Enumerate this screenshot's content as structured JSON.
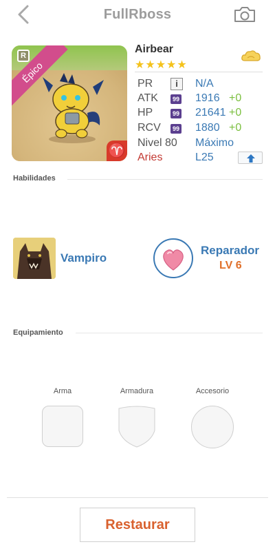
{
  "header": {
    "title": "FullRboss"
  },
  "monster": {
    "name": "Airbear",
    "stars": "★★★★★",
    "rarity": "Épico",
    "rank_badge": "R",
    "sign_glyph": "♈",
    "stats": [
      {
        "label": "PR",
        "badge": "i",
        "value": "N/A",
        "plus": ""
      },
      {
        "label": "ATK",
        "badge": "99",
        "value": "1916",
        "plus": "+0"
      },
      {
        "label": "HP",
        "badge": "99",
        "value": "21641",
        "plus": "+0"
      },
      {
        "label": "RCV",
        "badge": "99",
        "value": "1880",
        "plus": "+0"
      }
    ],
    "level": {
      "label": "Nivel 80",
      "value": "Máximo"
    },
    "sign": {
      "label": "Aries",
      "value": "L25"
    }
  },
  "skills": {
    "section_label": "Habilidades",
    "active": {
      "name": "Vampiro",
      "icon": "werewolf-icon"
    },
    "leader": {
      "name": "Reparador",
      "level": "LV 6",
      "icon": "heart-icon"
    }
  },
  "equipment": {
    "section_label": "Equipamiento",
    "slots": [
      {
        "label": "Arma"
      },
      {
        "label": "Armadura"
      },
      {
        "label": "Accesorio"
      }
    ]
  },
  "footer": {
    "restore_label": "Restaurar"
  },
  "colors": {
    "accent_blue": "#3a79b4",
    "accent_orange": "#d9612e",
    "epic_pink": "#d24d8c",
    "star_yellow": "#f4c21b"
  }
}
